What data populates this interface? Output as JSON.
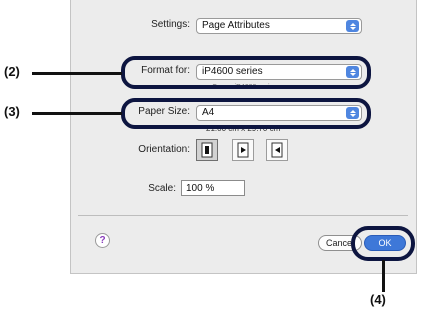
{
  "dialog": {
    "settings": {
      "label": "Settings:",
      "value": "Page Attributes"
    },
    "format_for": {
      "label": "Format for:",
      "value": "iP4600 series",
      "sub": "Canon iP4600 series"
    },
    "paper_size": {
      "label": "Paper Size:",
      "value": "A4",
      "dimensions": "21.00 cm x 29.70 cm"
    },
    "orientation": {
      "label": "Orientation:"
    },
    "scale": {
      "label": "Scale:",
      "value": "100 %"
    },
    "help": "?",
    "cancel_label": "Cancel",
    "ok_label": "OK"
  },
  "callouts": {
    "c2": "(2)",
    "c3": "(3)",
    "c4": "(4)"
  },
  "colors": {
    "accent": "#3e78d8",
    "callout": "#0d1540"
  },
  "icons": [
    "portrait-icon",
    "landscape-icon",
    "reverse-landscape-icon",
    "help-icon",
    "chevron-updown-icon"
  ]
}
